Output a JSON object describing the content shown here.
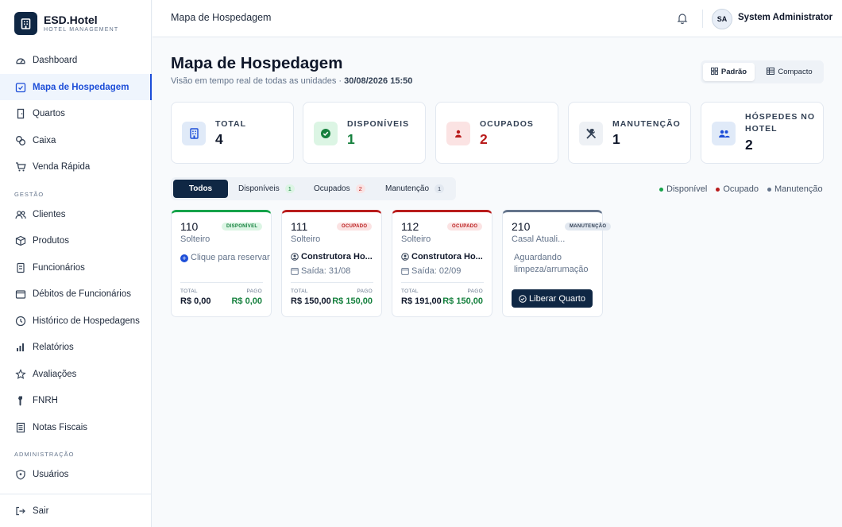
{
  "brand": {
    "name": "ESD.Hotel",
    "subtitle": "HOTEL MANAGEMENT"
  },
  "sidebar": {
    "items": [
      {
        "label": "Dashboard",
        "icon": "dashboard-icon"
      },
      {
        "label": "Mapa de Hospedagem",
        "icon": "map-icon",
        "active": true
      },
      {
        "label": "Quartos",
        "icon": "door-icon"
      },
      {
        "label": "Caixa",
        "icon": "cash-icon"
      },
      {
        "label": "Venda Rápida",
        "icon": "cart-icon"
      }
    ],
    "section_gestao": "GESTÃO",
    "gestao_items": [
      {
        "label": "Clientes",
        "icon": "users-icon"
      },
      {
        "label": "Produtos",
        "icon": "box-icon"
      },
      {
        "label": "Funcionários",
        "icon": "badge-icon"
      },
      {
        "label": "Débitos de Funcionários",
        "icon": "wallet-icon"
      },
      {
        "label": "Histórico de Hospedagens",
        "icon": "history-icon"
      },
      {
        "label": "Relatórios",
        "icon": "chart-icon"
      },
      {
        "label": "Avaliações",
        "icon": "star-icon"
      },
      {
        "label": "FNRH",
        "icon": "pen-icon"
      },
      {
        "label": "Notas Fiscais",
        "icon": "receipt-icon"
      }
    ],
    "section_admin": "ADMINISTRAÇÃO",
    "admin_items": [
      {
        "label": "Usuários",
        "icon": "shield-icon"
      }
    ],
    "logout": "Sair"
  },
  "header": {
    "title": "Mapa de Hospedagem",
    "user_initials": "SA",
    "user_name": "System Administrator"
  },
  "page": {
    "title": "Mapa de Hospedagem",
    "subtitle_prefix": "Visão em tempo real de todas as unidades · ",
    "datetime": "30/08/2026 15:50",
    "view_standard": "Padrão",
    "view_compact": "Compacto"
  },
  "stats": [
    {
      "label": "TOTAL",
      "value": "4",
      "icon": "building-icon",
      "color": "#1d4ed8",
      "bg": "#e0eaf8"
    },
    {
      "label": "DISPONÍVEIS",
      "value": "1",
      "icon": "check-circle-icon",
      "color": "#15803d",
      "bg": "#dcf5e4"
    },
    {
      "label": "OCUPADOS",
      "value": "2",
      "icon": "person-icon",
      "color": "#b91c1c",
      "bg": "#fbe3e3"
    },
    {
      "label": "MANUTENÇÃO",
      "value": "1",
      "icon": "tools-icon",
      "color": "#334155",
      "bg": "#eef1f5"
    },
    {
      "label": "HÓSPEDES NO HOTEL",
      "value": "2",
      "icon": "group-icon",
      "color": "#1d4ed8",
      "bg": "#e0eaf8"
    }
  ],
  "filters": [
    {
      "label": "Todos",
      "active": true
    },
    {
      "label": "Disponíveis",
      "count": "1",
      "color": "#15803d",
      "bg": "#dcf5e4"
    },
    {
      "label": "Ocupados",
      "count": "2",
      "color": "#b91c1c",
      "bg": "#fbe3e3"
    },
    {
      "label": "Manutenção",
      "count": "1",
      "color": "#334155",
      "bg": "#e2e8f0"
    }
  ],
  "legend": [
    {
      "label": "Disponível",
      "color": "#16a34a"
    },
    {
      "label": "Ocupado",
      "color": "#b91c1c"
    },
    {
      "label": "Manutenção",
      "color": "#64748b"
    }
  ],
  "rooms": [
    {
      "number": "110",
      "type": "Solteiro",
      "status": "DISPONÍVEL",
      "reserve_text": "Clique para reservar",
      "total_label": "TOTAL",
      "paid_label": "PAGO",
      "total": "R$ 0,00",
      "paid": "R$ 0,00"
    },
    {
      "number": "111",
      "type": "Solteiro",
      "status": "OCUPADO",
      "guest": "Construtora Ho...",
      "checkout": "Saída: 31/08",
      "total_label": "TOTAL",
      "paid_label": "PAGO",
      "total": "R$ 150,00",
      "paid": "R$ 150,00"
    },
    {
      "number": "112",
      "type": "Solteiro",
      "status": "OCUPADO",
      "guest": "Construtora Ho...",
      "checkout": "Saída: 02/09",
      "total_label": "TOTAL",
      "paid_label": "PAGO",
      "total": "R$ 191,00",
      "paid": "R$ 150,00"
    },
    {
      "number": "210",
      "type": "Casal Atuali...",
      "status": "MANUTENÇÃO",
      "waiting_text": "Aguardando limpeza/arrumação",
      "release_label": "Liberar Quarto"
    }
  ],
  "colors": {
    "primary": "#0f2744",
    "accent": "#1d4ed8",
    "available": "#16a34a",
    "occupied": "#b91c1c",
    "maintenance": "#64748b"
  }
}
